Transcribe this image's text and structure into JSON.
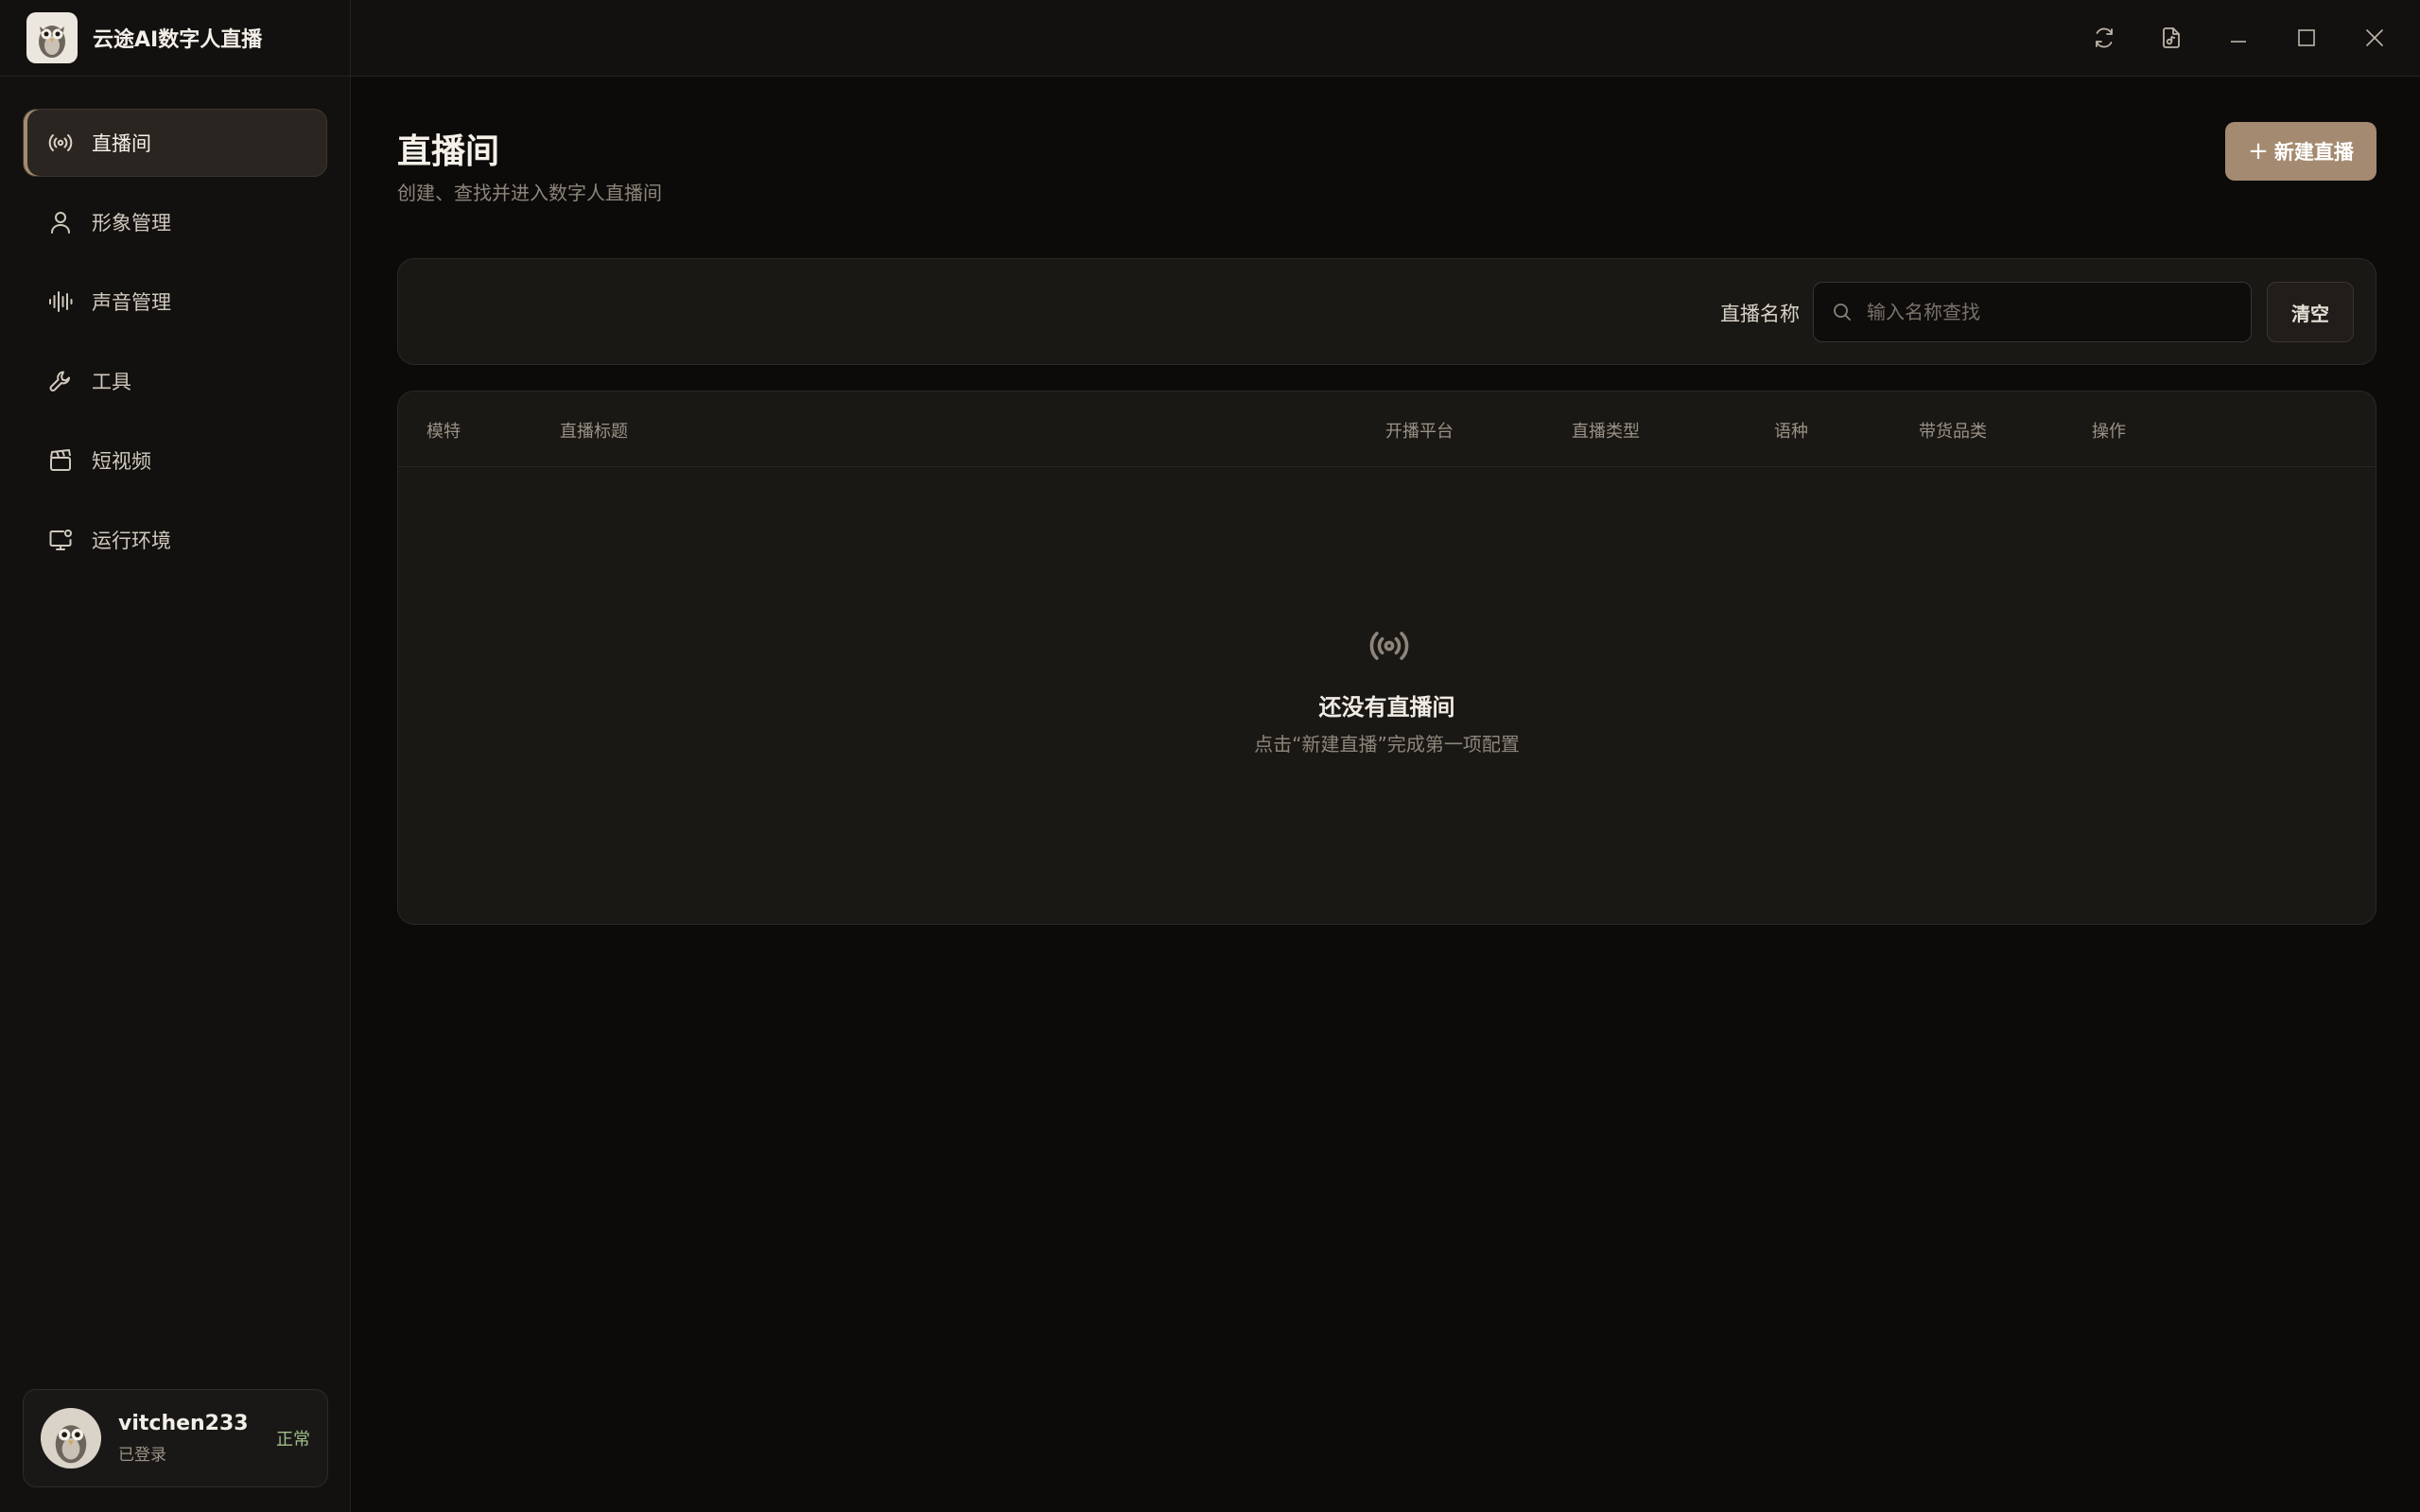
{
  "app": {
    "title": "云途AI数字人直播"
  },
  "sidebar": {
    "items": [
      {
        "label": "直播间",
        "icon": "broadcast-icon",
        "active": true
      },
      {
        "label": "形象管理",
        "icon": "user-icon",
        "active": false
      },
      {
        "label": "声音管理",
        "icon": "waveform-icon",
        "active": false
      },
      {
        "label": "工具",
        "icon": "wrench-icon",
        "active": false
      },
      {
        "label": "短视频",
        "icon": "clapperboard-icon",
        "active": false
      },
      {
        "label": "运行环境",
        "icon": "monitor-settings-icon",
        "active": false
      }
    ]
  },
  "user": {
    "name": "vitchen233",
    "sub": "已登录",
    "status": "正常"
  },
  "page": {
    "title": "直播间",
    "subtitle": "创建、查找并进入数字人直播间",
    "new_button": "新建直播"
  },
  "filter": {
    "label": "直播名称",
    "placeholder": "输入名称查找",
    "value": "",
    "clear_button": "清空"
  },
  "table": {
    "columns": [
      "模特",
      "直播标题",
      "开播平台",
      "直播类型",
      "语种",
      "带货品类",
      "操作"
    ],
    "rows": [],
    "empty_title": "还没有直播间",
    "empty_desc": "点击“新建直播”完成第一项配置"
  },
  "colors": {
    "accent": "#a48a70",
    "background": "#0c0b0a",
    "panel": "#1a1815",
    "status_ok": "#9fbf8a"
  }
}
